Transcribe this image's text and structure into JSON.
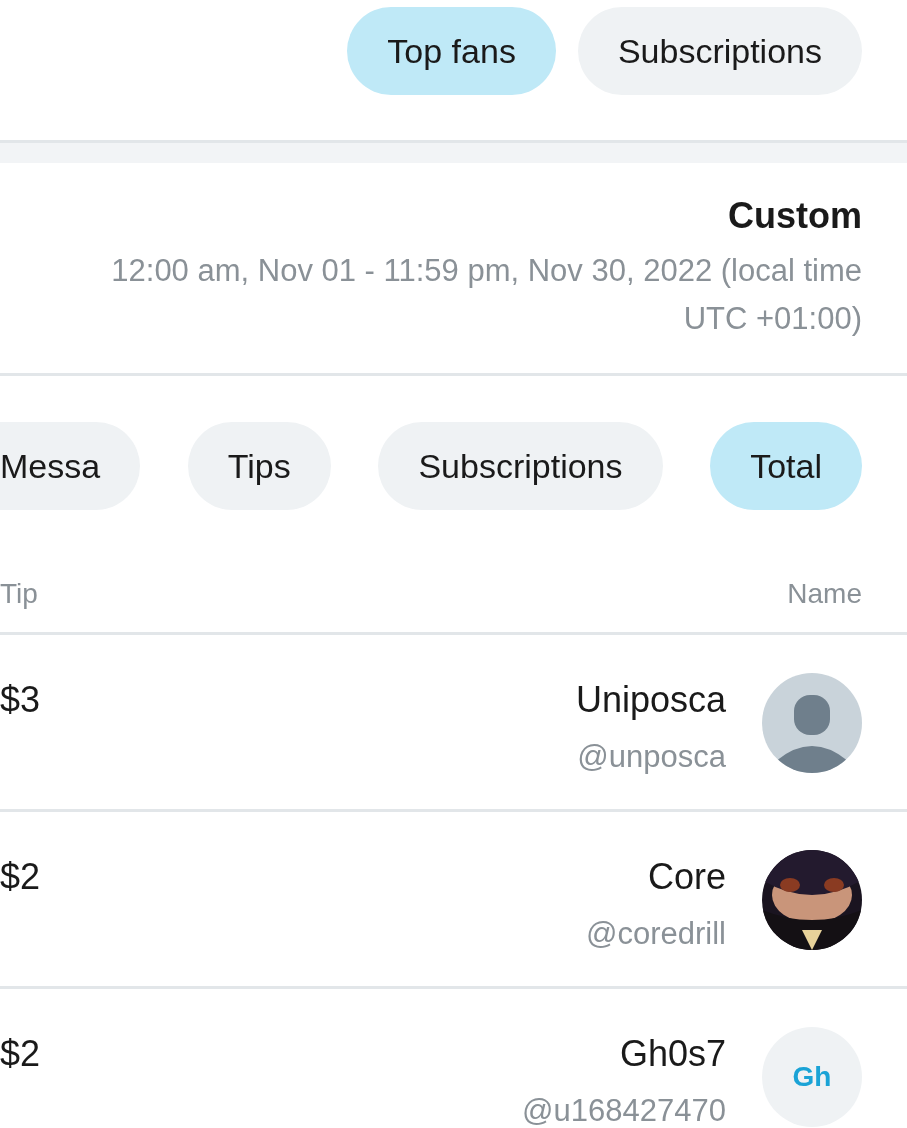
{
  "view_tabs": [
    {
      "label": "Top fans",
      "selected": true
    },
    {
      "label": "Subscriptions",
      "selected": false
    }
  ],
  "period": {
    "title": "Custom",
    "range": "12:00 am, Nov 01 - 11:59 pm, Nov 30, 2022 (local time UTC +01:00)"
  },
  "filter_tabs": [
    {
      "label": "Messa",
      "selected": false
    },
    {
      "label": "Tips",
      "selected": false
    },
    {
      "label": "Subscriptions",
      "selected": false
    },
    {
      "label": "Total",
      "selected": true
    }
  ],
  "table": {
    "columns": [
      "Tip",
      "Name"
    ],
    "rows": [
      {
        "avatar": {
          "kind": "placeholder"
        },
        "name": "Uniposca",
        "handle": "@unposca",
        "tip": "$3"
      },
      {
        "name": "Core",
        "handle": "@coredrill",
        "tip": "$2"
      },
      {
        "avatar": {
          "kind": "initials",
          "text": "Gh"
        },
        "name": "Gh0s7",
        "handle": "@u168427470",
        "tip": "$2"
      }
    ]
  }
}
